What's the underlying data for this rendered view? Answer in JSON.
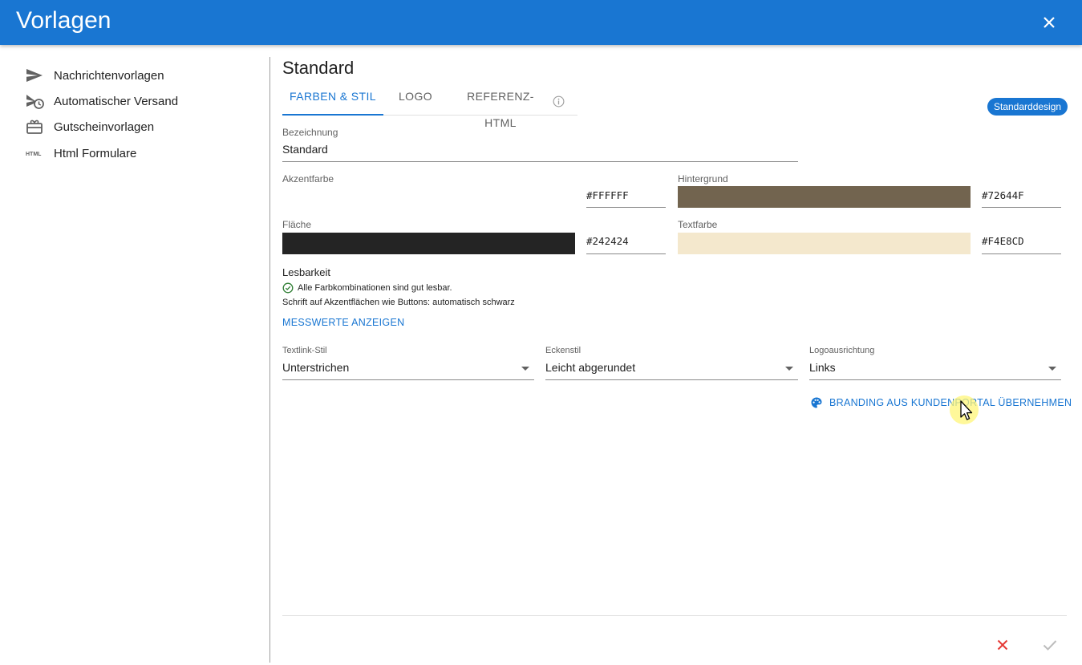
{
  "appbar": {
    "title": "Vorlagen",
    "close_icon": "close-icon"
  },
  "sidebar": {
    "items": [
      {
        "label": "Nachrichtenvorlagen",
        "icon": "send-icon"
      },
      {
        "label": "Automatischer Versand",
        "icon": "scheduled-send-icon"
      },
      {
        "label": "Gutscheinvorlagen",
        "icon": "gift-card-icon"
      },
      {
        "label": "Html Formulare",
        "icon": "html-icon"
      }
    ]
  },
  "main": {
    "title": "Standard",
    "tabs": [
      {
        "label": "FARBEN & STIL",
        "active": true
      },
      {
        "label": "LOGO",
        "active": false
      },
      {
        "label": "REFERENZ-HTML",
        "active": false,
        "icon": "info-icon"
      }
    ],
    "badge": "Standarddesign",
    "bezeichnung": {
      "label": "Bezeichnung",
      "value": "Standard"
    },
    "colors": {
      "akzentfarbe": {
        "label": "Akzentfarbe",
        "value": "#FFFFFF",
        "swatch": "#FFFFFF"
      },
      "hintergrund": {
        "label": "Hintergrund",
        "value": "#72644F",
        "swatch": "#72644F"
      },
      "flaeche": {
        "label": "Fläche",
        "value": "#242424",
        "swatch": "#242424"
      },
      "textfarbe": {
        "label": "Textfarbe",
        "value": "#F4E8CD",
        "swatch": "#F4E8CD"
      }
    },
    "lesbarkeit": {
      "title": "Lesbarkeit",
      "status": "Alle Farbkombinationen sind gut lesbar.",
      "status_icon": "check-circle-icon",
      "hint": "Schrift auf Akzentflächen wie Buttons: automatisch schwarz",
      "link": "MESSWERTE ANZEIGEN"
    },
    "selects": {
      "textlink": {
        "label": "Textlink-Stil",
        "value": "Unterstrichen"
      },
      "eckenstil": {
        "label": "Eckenstil",
        "value": "Leicht abgerundet"
      },
      "logoausrichtung": {
        "label": "Logoausrichtung",
        "value": "Links"
      }
    },
    "branding_button": {
      "label": "BRANDING AUS KUNDENPORTAL ÜBERNEHMEN",
      "icon": "palette-icon"
    },
    "actions": {
      "cancel_icon": "close-icon",
      "confirm_icon": "check-icon"
    },
    "colors_ui": {
      "primary": "#1976d2",
      "cancel": "#e53935",
      "confirm_disabled": "#bdbdbd",
      "success": "#2e7d32"
    }
  }
}
